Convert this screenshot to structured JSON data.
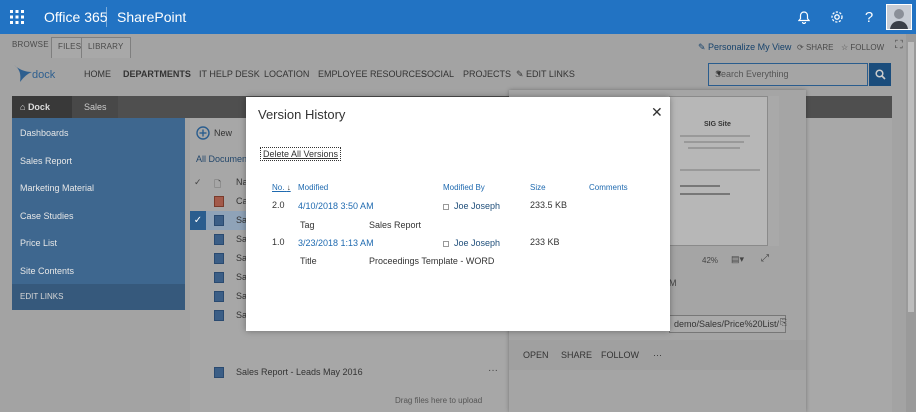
{
  "suite": {
    "app": "Office 365",
    "site": "SharePoint",
    "help": "?"
  },
  "ribbon": {
    "tabs": [
      "BROWSE",
      "FILES",
      "LIBRARY"
    ],
    "actions": {
      "personalize": "Personalize My View",
      "share": "SHARE",
      "follow": "FOLLOW"
    }
  },
  "nav": {
    "logo_text": "dock",
    "items": [
      "HOME",
      "DEPARTMENTS",
      "IT HELP DESK",
      "LOCATION",
      "EMPLOYEE RESOURCES",
      "SOCIAL",
      "PROJECTS",
      "EDIT LINKS"
    ],
    "search_placeholder": "Search Everything"
  },
  "breadcrumb": [
    "Dock",
    "Sales"
  ],
  "leftnav": {
    "items": [
      "Dashboards",
      "Sales Report",
      "Marketing Material",
      "Case Studies",
      "Price List",
      "Site Contents"
    ],
    "edit_links": "EDIT LINKS"
  },
  "library": {
    "new_label": "New",
    "view_label": "All Documen",
    "column_name": "Na",
    "rows": [
      "Ca",
      "Sa",
      "Sa",
      "Sa",
      "Sa",
      "Sa",
      "Sa"
    ],
    "last_row": "Sales Report - Leads May 2016",
    "drag_hint": "Drag files here to upload"
  },
  "preview": {
    "doc_title": "SIG Site",
    "zoom": "42%",
    "m_text": "M",
    "url_text": "demo/Sales/Price%20List/",
    "actions": [
      "OPEN",
      "SHARE",
      "FOLLOW",
      "···"
    ]
  },
  "dialog": {
    "title": "Version History",
    "delete_all": "Delete All Versions",
    "headers": {
      "no": "No.",
      "modified": "Modified",
      "modified_by": "Modified By",
      "size": "Size",
      "comments": "Comments"
    },
    "versions": [
      {
        "no": "2.0",
        "modified": "4/10/2018 3:50 AM",
        "by": "Joe Joseph",
        "size": "233.5 KB",
        "prop_name": "Tag",
        "prop_value": "Sales Report"
      },
      {
        "no": "1.0",
        "modified": "3/23/2018 1:13 AM",
        "by": "Joe Joseph",
        "size": "233 KB",
        "prop_name": "Title",
        "prop_value": "Proceedings Template - WORD"
      }
    ]
  }
}
